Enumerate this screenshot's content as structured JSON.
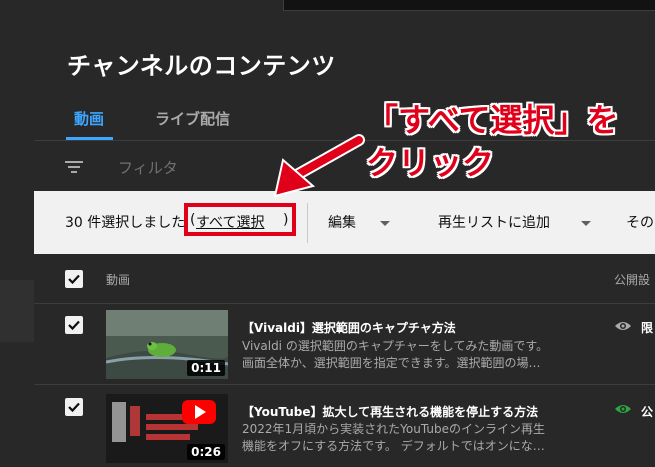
{
  "page": {
    "title": "チャンネルのコンテンツ"
  },
  "tabs": [
    {
      "label": "動画"
    },
    {
      "label": "ライブ配信"
    }
  ],
  "filter": {
    "label": "フィルタ"
  },
  "selection_bar": {
    "count_text": "30 件選択しました",
    "open_paren": "(",
    "select_all_label": "すべて選択",
    "close_paren": ")",
    "edit_label": "編集",
    "add_to_playlist_label": "再生リストに追加",
    "other_label": "その"
  },
  "table_header": {
    "video_col": "動画",
    "visibility_col": "公開設"
  },
  "videos": [
    {
      "title": "【Vivaldi】選択範囲のキャプチャ方法",
      "desc_line1": "Vivaldi の選択範囲のキャプチャーをしてみた動画です。",
      "desc_line2": "画面全体か、選択範囲を指定できます。選択範囲の場…",
      "duration": "0:11",
      "visibility": "限"
    },
    {
      "title": "【YouTube】拡大して再生される機能を停止する方法",
      "desc_line1": "2022年1月頃から実装されたYouTubeのインライン再生",
      "desc_line2": "機能をオフにする方法です。 デフォルトではオンにな…",
      "duration": "0:26",
      "visibility": "公"
    }
  ],
  "annotation": {
    "line1": "「すべて選択」を",
    "line2": "クリック"
  },
  "colors": {
    "accent_blue": "#3ea6ff",
    "annotation_red": "#e0001a",
    "eye_green": "#2ba640"
  }
}
